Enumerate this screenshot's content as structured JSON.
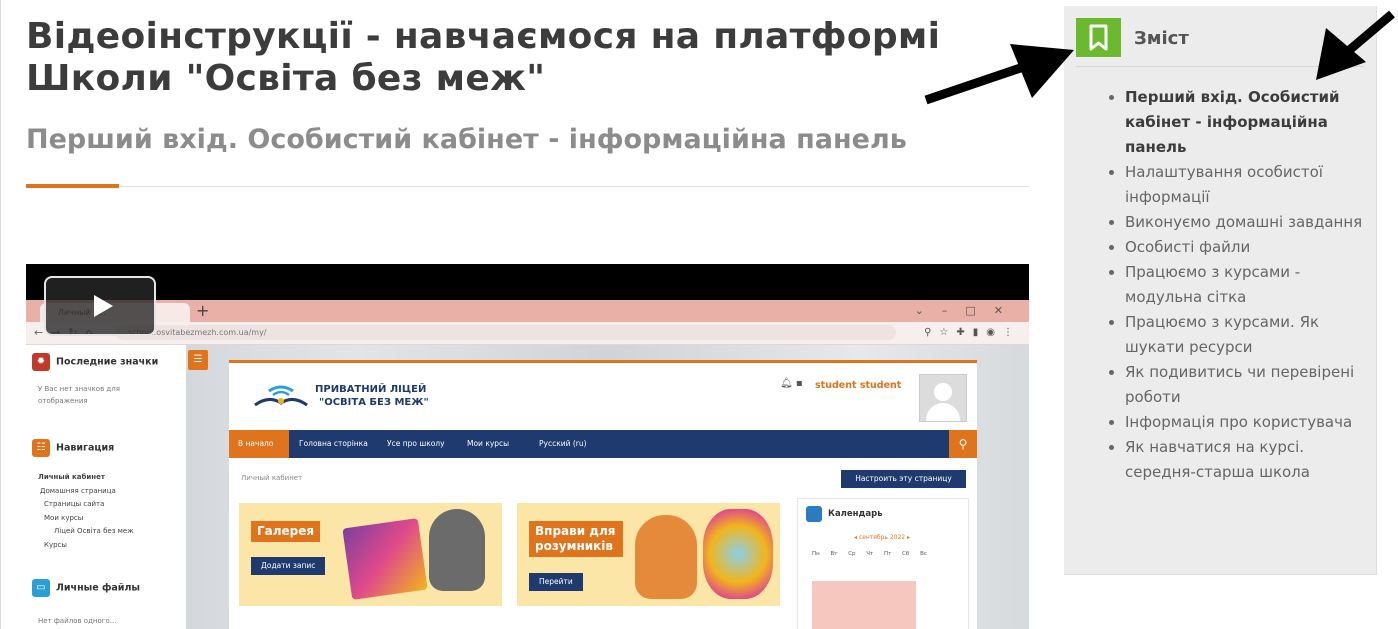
{
  "article": {
    "title": "Відеоінструкції - навчаємося на платформі Школи \"Освіта без меж\"",
    "subtitle": "Перший вхід. Особистий кабінет - інформаційна панель"
  },
  "video": {
    "browser": {
      "tab_label": "Личный к...",
      "url": "school.osvitabezmezh.com.ua/my/"
    },
    "left_blocks": {
      "badges_title": "Последние значки",
      "badges_text": "У Вас нет значков для отображения",
      "navigation_title": "Навигация",
      "navigation_items": [
        "Личный кабинет",
        "Домашняя страница",
        "Страницы сайта",
        "Мои курсы",
        "Ліцей Освіта без меж",
        "Курсы"
      ],
      "files_title": "Личные файлы",
      "files_text": "Нет файлов одного..."
    },
    "site": {
      "logo_line1": "ПРИВАТНИЙ ЛІЦЕЙ",
      "logo_line2": "\"ОСВІТА БЕЗ МЕЖ\"",
      "user_name": "student student",
      "nav": [
        "В начало",
        "Головна сторінка",
        "Усе про школу",
        "Мои курсы",
        "Русский (ru)"
      ],
      "breadcrumb": "Личный кабинет",
      "customize_button": "Настроить эту страницу",
      "banner1_title": "Галерея",
      "banner1_button": "Додати запис",
      "banner2_title": "Вправи для розумників",
      "banner2_button": "Перейти",
      "calendar_title": "Календарь",
      "calendar_month": "сентябрь 2022",
      "calendar_days": "Пн Вт Ср Чт Пт Сб Вс"
    }
  },
  "toc": {
    "title": "Зміст",
    "items": [
      "Перший вхід. Особистий кабінет - інформаційна панель",
      "Налаштування особистої інформації",
      "Виконуємо домашні завдання",
      "Особисті файли",
      "Працюємо з курсами - модульна сітка",
      "Працюємо з курсами. Як шукати ресурси",
      "Як подивитись чи перевірені роботи",
      "Інформація про користувача",
      "Як навчатися на курсі. середня-старша школа"
    ]
  },
  "colors": {
    "accent_orange": "#e0741c",
    "toc_icon_green": "#6ab92e",
    "site_navy": "#1e3a6e"
  }
}
